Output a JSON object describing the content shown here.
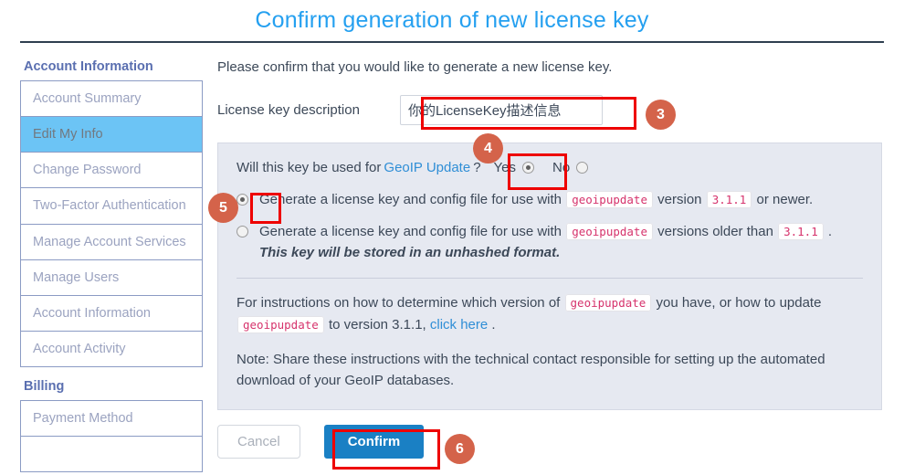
{
  "page": {
    "title": "Confirm generation of new license key"
  },
  "sidebar": {
    "groups": [
      {
        "title": "Account Information",
        "items": [
          {
            "label": "Account Summary",
            "active": false
          },
          {
            "label": "Edit My Info",
            "active": true
          },
          {
            "label": "Change Password",
            "active": false
          },
          {
            "label": "Two-Factor Authentication",
            "active": false
          },
          {
            "label": "Manage Account Services",
            "active": false
          },
          {
            "label": "Manage Users",
            "active": false
          },
          {
            "label": "Account Information",
            "active": false
          },
          {
            "label": "Account Activity",
            "active": false
          }
        ]
      },
      {
        "title": "Billing",
        "items": [
          {
            "label": "Payment Method",
            "active": false
          }
        ]
      }
    ]
  },
  "main": {
    "intro": "Please confirm that you would like to generate a new license key.",
    "description_label": "License key description",
    "description_value": "你的LicenseKey描述信息",
    "description_placeholder": "License key description",
    "geoip_question_before": "Will this key be used for",
    "geoip_question_link": "GeoIP Update",
    "geoip_question_after": "?",
    "yes_label": "Yes",
    "no_label": "No",
    "yes_selected": true,
    "no_selected": false,
    "options": [
      {
        "selected": true,
        "text_1": "Generate a license key and config file for use with",
        "code_1": "geoipupdate",
        "text_2": "version",
        "code_2": "3.1.1",
        "text_3": "or newer.",
        "warning": ""
      },
      {
        "selected": false,
        "text_1": "Generate a license key and config file for use with",
        "code_1": "geoipupdate",
        "text_2": "versions older than",
        "code_2": "3.1.1",
        "text_3": ".",
        "warning": "This key will be stored in an unhashed format."
      }
    ],
    "instructions": {
      "part_1": "For instructions on how to determine which version of",
      "code_1": "geoipupdate",
      "part_2": "you have, or how to update",
      "code_2": "geoipupdate",
      "part_3": "to version 3.1.1,",
      "link": "click here",
      "part_4": "."
    },
    "note": "Note: Share these instructions with the technical contact responsible for setting up the automated download of your GeoIP databases.",
    "cancel_label": "Cancel",
    "confirm_label": "Confirm"
  },
  "annotations": {
    "badges": [
      {
        "number": "3"
      },
      {
        "number": "4"
      },
      {
        "number": "5"
      },
      {
        "number": "6"
      }
    ],
    "badge_color": "#d4634a",
    "highlight_color": "#ee0000"
  },
  "colors": {
    "title": "#25a0f0",
    "link": "#2f8ed6",
    "active_item": "#6cc4f5",
    "panel_bg": "#e6e9f1",
    "confirm_button": "#1a80c4",
    "code_text": "#d6336c"
  }
}
